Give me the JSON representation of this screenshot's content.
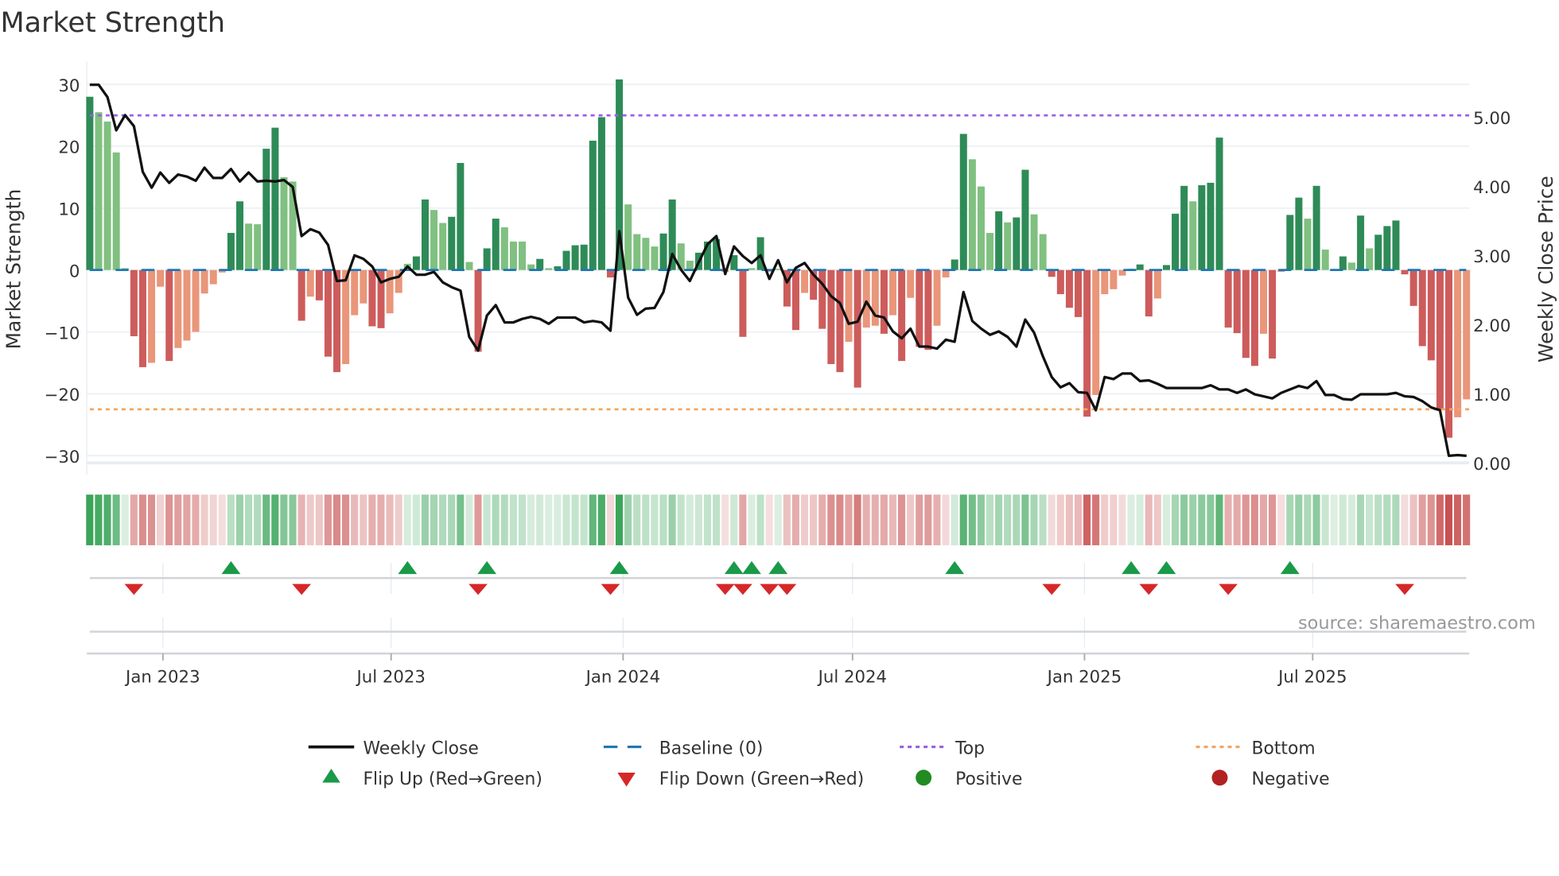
{
  "chart_data": {
    "type": "bar",
    "title": "Market Strength",
    "ylabel": "Market Strength",
    "ylabel_right": "Weekly Close Price",
    "ylim": [
      -31.8,
      32.4
    ],
    "ylim_right": [
      -0.06,
      5.69
    ],
    "yticks": [
      30,
      20,
      10,
      0,
      -10,
      -20,
      -30
    ],
    "ytick_labels": [
      "30",
      "20",
      "10",
      "0",
      "−10",
      "−20",
      "−30"
    ],
    "yticks_right": [
      5,
      4,
      3,
      2,
      1,
      0
    ],
    "ytick_labels_right": [
      "5.00",
      "4.00",
      "3.00",
      "2.00",
      "1.00",
      "0.00"
    ],
    "first_week": "2022-11-04",
    "frequency": "weekly",
    "xticks": [
      {
        "label": "Jan 2023",
        "date": "2023-01-01"
      },
      {
        "label": "Jul 2023",
        "date": "2023-07-01"
      },
      {
        "label": "Jan 2024",
        "date": "2024-01-01"
      },
      {
        "label": "Jul 2024",
        "date": "2024-07-01"
      },
      {
        "label": "Jan 2025",
        "date": "2025-01-01"
      },
      {
        "label": "Jul 2025",
        "date": "2025-07-01"
      }
    ],
    "top_level": 25,
    "bottom_level": -22.5,
    "baseline": 0,
    "strength": [
      28,
      25.5,
      24,
      19,
      0.3,
      -10.7,
      -15.7,
      -15,
      -2.7,
      -14.7,
      -12.6,
      -11.4,
      -10,
      -3.8,
      -2.3,
      -0.4,
      6,
      11.1,
      7.5,
      7.4,
      19.6,
      23,
      15,
      14.3,
      -8.2,
      -4.3,
      -4.9,
      -14,
      -16.5,
      -15.2,
      -7.3,
      -5.4,
      -9.1,
      -9.4,
      -7,
      -3.7,
      1,
      2.2,
      11.4,
      9.7,
      7.6,
      8.6,
      17.3,
      1.3,
      -13.2,
      3.5,
      8.3,
      6.9,
      4.6,
      4.6,
      0.9,
      1.8,
      0.3,
      0.6,
      3.1,
      4,
      4.1,
      20.9,
      24.7,
      -1.2,
      30.8,
      10.6,
      5.8,
      5.2,
      3.8,
      5.9,
      11.4,
      4.3,
      1.5,
      2.8,
      4.6,
      5,
      -0.3,
      2.4,
      -10.8,
      0.3,
      5.3,
      -0.3,
      0.2,
      -5.9,
      -9.7,
      -3.7,
      -4.8,
      -9.5,
      -15.2,
      -16.5,
      -11.6,
      -19,
      -9.3,
      -9,
      -10.3,
      -7.3,
      -14.7,
      -4.5,
      -12.4,
      -12.9,
      -9,
      -1.2,
      1.7,
      22,
      17.9,
      13.5,
      6,
      9.5,
      7.7,
      8.5,
      16.2,
      9,
      5.8,
      -1.1,
      -3.9,
      -6.1,
      -7.6,
      -23.7,
      -20.2,
      -3.9,
      -3.1,
      -0.9,
      0.2,
      0.9,
      -7.5,
      -4.6,
      0.8,
      9.1,
      13.6,
      11.1,
      13.7,
      14.1,
      21.4,
      -9.3,
      -10.2,
      -14.2,
      -15.5,
      -10.3,
      -14.3,
      -0.3,
      8.9,
      11.7,
      8.3,
      13.6,
      3.3,
      0,
      2.2,
      1.2,
      8.8,
      3.5,
      5.7,
      7.1,
      8,
      -0.7,
      -5.8,
      -12.3,
      -14.6,
      -22.5,
      -27.1,
      -23.8,
      -20.9
    ],
    "strong": [
      1,
      0,
      0,
      0,
      0,
      1,
      1,
      0,
      0,
      1,
      0,
      0,
      0,
      0,
      0,
      0,
      1,
      1,
      0,
      0,
      1,
      1,
      0,
      0,
      1,
      0,
      1,
      1,
      1,
      0,
      0,
      0,
      1,
      1,
      0,
      0,
      0,
      1,
      1,
      0,
      0,
      1,
      1,
      0,
      1,
      1,
      1,
      0,
      0,
      0,
      0,
      1,
      0,
      1,
      1,
      1,
      1,
      1,
      1,
      1,
      1,
      0,
      0,
      0,
      0,
      1,
      1,
      0,
      0,
      1,
      1,
      1,
      0,
      1,
      1,
      0,
      1,
      0,
      0,
      1,
      1,
      0,
      1,
      1,
      1,
      1,
      0,
      1,
      0,
      0,
      1,
      0,
      1,
      0,
      1,
      1,
      0,
      0,
      1,
      1,
      0,
      0,
      0,
      1,
      0,
      1,
      1,
      0,
      0,
      1,
      1,
      1,
      1,
      1,
      0,
      0,
      0,
      0,
      0,
      1,
      1,
      0,
      1,
      1,
      1,
      0,
      1,
      1,
      1,
      1,
      1,
      1,
      1,
      0,
      1,
      0,
      1,
      1,
      0,
      1,
      0,
      0,
      1,
      0,
      1,
      0,
      1,
      1,
      1,
      1,
      1,
      1,
      1,
      1,
      1,
      0,
      0
    ],
    "weekly_close": [
      5.47,
      5.47,
      5.29,
      4.81,
      5.03,
      4.87,
      4.21,
      3.98,
      4.2,
      4.05,
      4.17,
      4.14,
      4.08,
      4.27,
      4.12,
      4.12,
      4.25,
      4.07,
      4.2,
      4.07,
      4.08,
      4.07,
      4.09,
      3.99,
      3.28,
      3.38,
      3.33,
      3.15,
      2.63,
      2.64,
      3.0,
      2.95,
      2.84,
      2.61,
      2.66,
      2.69,
      2.84,
      2.72,
      2.72,
      2.76,
      2.61,
      2.54,
      2.49,
      1.82,
      1.62,
      2.13,
      2.28,
      2.03,
      2.03,
      2.08,
      2.11,
      2.08,
      2.01,
      2.1,
      2.1,
      2.1,
      2.03,
      2.05,
      2.03,
      1.91,
      3.35,
      2.39,
      2.14,
      2.23,
      2.24,
      2.47,
      3.02,
      2.79,
      2.63,
      2.9,
      3.16,
      3.28,
      2.73,
      3.13,
      2.99,
      2.89,
      3.0,
      2.66,
      2.93,
      2.61,
      2.82,
      2.89,
      2.72,
      2.59,
      2.41,
      2.31,
      2.01,
      2.04,
      2.33,
      2.13,
      2.1,
      1.9,
      1.8,
      1.94,
      1.68,
      1.68,
      1.65,
      1.78,
      1.75,
      2.47,
      2.05,
      1.94,
      1.85,
      1.9,
      1.82,
      1.68,
      2.07,
      1.88,
      1.54,
      1.24,
      1.09,
      1.15,
      1.02,
      1.01,
      0.76,
      1.24,
      1.21,
      1.29,
      1.29,
      1.18,
      1.19,
      1.14,
      1.08,
      1.08,
      1.08,
      1.08,
      1.08,
      1.12,
      1.06,
      1.06,
      1.01,
      1.06,
      0.99,
      0.96,
      0.93,
      1.01,
      1.06,
      1.11,
      1.08,
      1.18,
      0.98,
      0.98,
      0.92,
      0.91,
      0.99,
      0.99,
      0.99,
      0.99,
      1.01,
      0.96,
      0.95,
      0.89,
      0.8,
      0.76,
      0.1,
      0.11,
      0.1
    ],
    "flip_up_weeks": [
      16,
      36,
      45,
      60,
      73,
      75,
      78,
      98,
      118,
      122,
      136
    ],
    "flip_down_weeks": [
      5,
      24,
      44,
      59,
      72,
      74,
      77,
      79,
      109,
      120,
      129,
      149
    ],
    "colors": {
      "positive_strong": "#2e8b57",
      "positive_weak": "#80c080",
      "negative_strong": "#cd5c5c",
      "negative_weak": "#e9967a",
      "close_line": "#111111",
      "baseline": "#1f77b4",
      "top": "#9b5fe0",
      "bottom": "#f4a460",
      "flip_up": "#1a9a48",
      "flip_down": "#d62728",
      "positive": "#228b22",
      "negative": "#b22222"
    },
    "legend": {
      "weekly_close": "Weekly Close",
      "baseline": "Baseline (0)",
      "top": "Top",
      "bottom": "Bottom",
      "flip_up": "Flip Up (Red→Green)",
      "flip_down": "Flip Down (Green→Red)",
      "positive": "Positive",
      "negative": "Negative"
    },
    "legend_position": "bottom-center"
  },
  "source": "source: sharemaestro.com"
}
